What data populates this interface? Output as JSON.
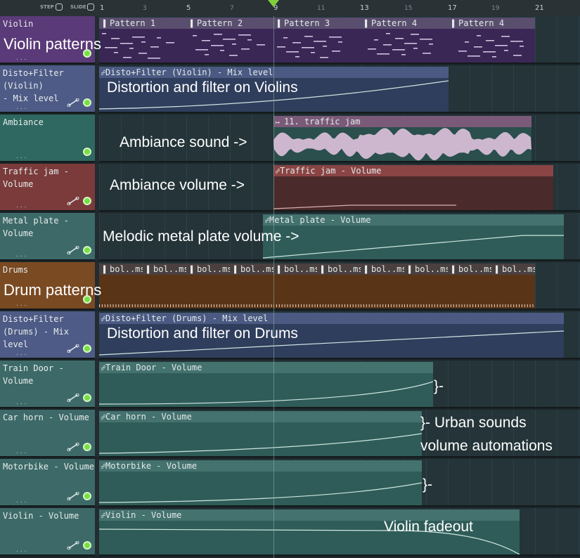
{
  "toolbar": {
    "step": "STEP",
    "slide": "SLIDE"
  },
  "ruler": {
    "major": [
      "1",
      "5",
      "9",
      "13",
      "17",
      "21"
    ],
    "minor": [
      "3",
      "7",
      "11",
      "15",
      "19"
    ]
  },
  "tracks": [
    {
      "name": "Violin"
    },
    {
      "name": "Disto+Filter (Violin)\n- Mix level"
    },
    {
      "name": "Ambiance"
    },
    {
      "name": "Traffic jam - Volume"
    },
    {
      "name": "Metal plate - Volume"
    },
    {
      "name": "Drums"
    },
    {
      "name": "Disto+Filter\n(Drums) - Mix level"
    },
    {
      "name": "Train Door - Volume"
    },
    {
      "name": "Car horn - Volume"
    },
    {
      "name": "Motorbike - Volume"
    },
    {
      "name": "Violin - Volume"
    }
  ],
  "clips": {
    "violin_patterns": [
      "Pattern 1",
      "Pattern 2",
      "Pattern 3",
      "Pattern 4",
      "Pattern 4"
    ],
    "disto_violin": "Disto+Filter (Violin) - Mix level",
    "ambiance": "11. traffic jam",
    "traffic_vol": "Traffic jam - Volume",
    "metal_vol": "Metal plate - Volume",
    "drum_patterns": [
      "bol..ms",
      "bol..ms",
      "bol..ms",
      "bol..ms",
      "bol..ms",
      "bol..ms",
      "bol..ms",
      "bol..ms",
      "bol..ms",
      "bol..ms"
    ],
    "disto_drums": "Disto+Filter (Drums) - Mix level",
    "train": "Train Door - Volume",
    "carhorn": "Car horn - Volume",
    "motorbike": "Motorbike - Volume",
    "violin_vol": "Violin - Volume"
  },
  "dots": "...",
  "annotations": {
    "violin_patterns": "Violin patterns",
    "disto_violin": "Distortion and filter on Violins",
    "ambiance": "Ambiance sound ->",
    "amb_volume": "Ambiance volume ->",
    "metal": "Melodic metal plate volume ->",
    "drums": "Drum patterns",
    "disto_drums": "Distortion and filter on Drums",
    "brace1": "}-",
    "urban1": "}- Urban sounds",
    "urban2": "volume automations",
    "brace2": "}-",
    "fadeout": "Violin fadeout"
  },
  "colors": {
    "violin": "#5a3a78",
    "automation": "#3d5a63",
    "ambiance": "#2f6860",
    "traffic": "#7b3b3b",
    "drums": "#7a4a22",
    "led": "#76e042"
  }
}
